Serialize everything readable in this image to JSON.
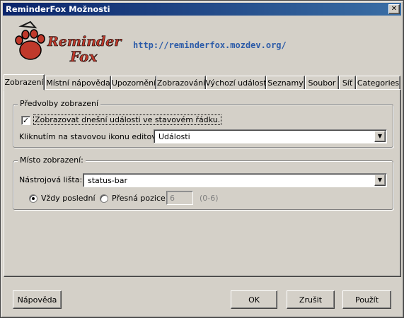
{
  "window": {
    "title": "ReminderFox Možnosti",
    "close_glyph": "✕"
  },
  "banner": {
    "logo_text": "Reminder",
    "logo_text2": "Fox",
    "url": "http://reminderfox.mozdev.org/"
  },
  "tabs": [
    {
      "label": "Zobrazení",
      "active": true
    },
    {
      "label": "Místní nápověda"
    },
    {
      "label": "Upozornění"
    },
    {
      "label": "Zobrazování"
    },
    {
      "label": "Výchozí událost"
    },
    {
      "label": "Seznamy"
    },
    {
      "label": "Soubor"
    },
    {
      "label": "Síť"
    },
    {
      "label": "Categories"
    }
  ],
  "prefs_group": {
    "title": "Předvolby zobrazení",
    "show_today_label": "Zobrazovat dnešní události ve stavovém řádku.",
    "show_today_checked": true,
    "click_label": "Kliknutím na stavovou ikonu editovat:",
    "click_value": "Události"
  },
  "location_group": {
    "title": "Místo zobrazení:",
    "toolbar_label": "Nástrojová lišta:",
    "toolbar_value": "status-bar",
    "always_last_label": "Vždy poslední",
    "exact_pos_label": "Přesná pozice",
    "position_value": "6",
    "range_label": "(0-6)"
  },
  "buttons": {
    "help": "Nápověda",
    "ok": "OK",
    "cancel": "Zrušit",
    "apply": "Použít"
  }
}
